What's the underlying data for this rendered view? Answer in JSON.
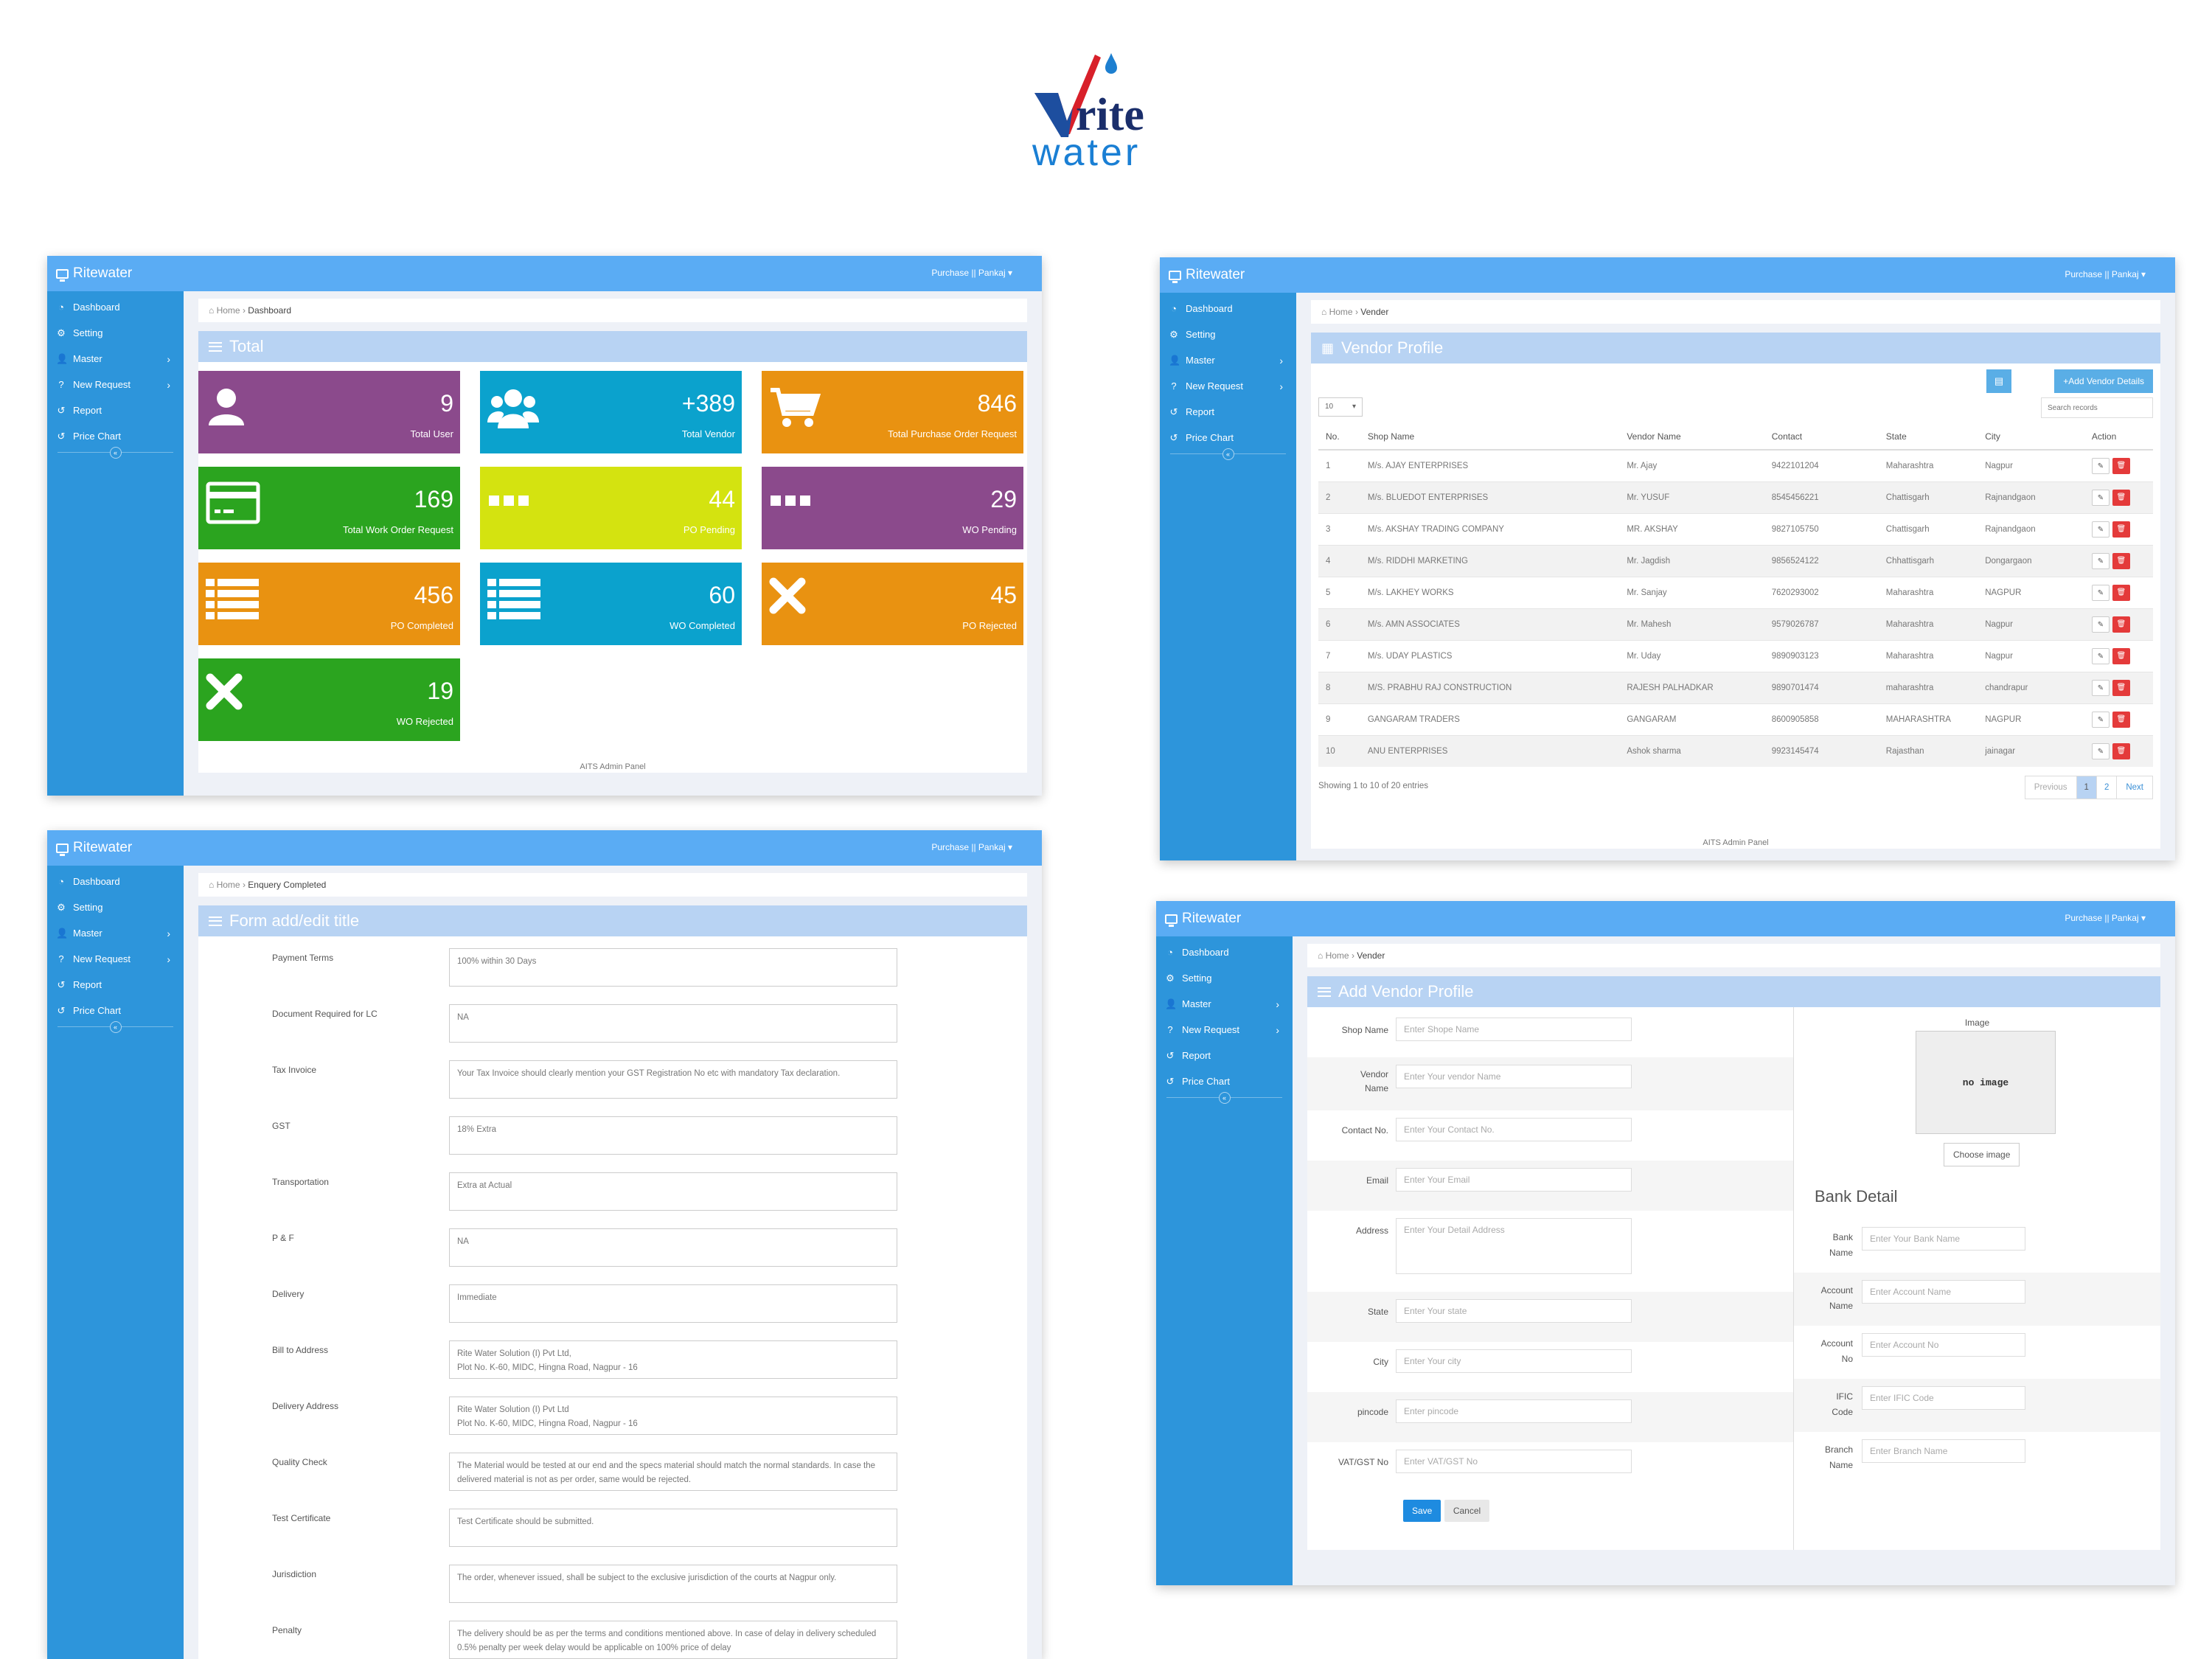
{
  "logo": {
    "top_text": "rite",
    "bottom_text": "water"
  },
  "common": {
    "brand": "Ritewater",
    "user": "Purchase || Pankaj",
    "nav": [
      {
        "label": "Dashboard",
        "icon": "dashboard-icon"
      },
      {
        "label": "Setting",
        "icon": "cogs-icon"
      },
      {
        "label": "Master",
        "icon": "user-icon"
      },
      {
        "label": "New Request",
        "icon": "question-icon"
      },
      {
        "label": "Report",
        "icon": "history-icon"
      },
      {
        "label": "Price Chart",
        "icon": "history-icon"
      }
    ],
    "home": "Home",
    "footer": "AITS Admin Panel"
  },
  "dashboard": {
    "crumb": "Dashboard",
    "title": "Total",
    "tiles": [
      {
        "value": "9",
        "label": "Total User",
        "color": "#8b4a8c",
        "icon": "user-icon"
      },
      {
        "value": "+389",
        "label": "Total Vendor",
        "color": "#0ba2cd",
        "icon": "users-icon"
      },
      {
        "value": "846",
        "label": "Total Purchase Order Request",
        "color": "#e99211",
        "icon": "cart-icon"
      },
      {
        "value": "169",
        "label": "Total Work Order Request",
        "color": "#2ba41f",
        "icon": "card-icon"
      },
      {
        "value": "44",
        "label": "PO Pending",
        "color": "#d4e310",
        "icon": "ellipsis-icon"
      },
      {
        "value": "29",
        "label": "WO Pending",
        "color": "#8b4a8c",
        "icon": "ellipsis-icon"
      },
      {
        "value": "456",
        "label": "PO Completed",
        "color": "#e99211",
        "icon": "list-icon"
      },
      {
        "value": "60",
        "label": "WO Completed",
        "color": "#0ba2cd",
        "icon": "list-icon"
      },
      {
        "value": "45",
        "label": "PO Rejected",
        "color": "#e99211",
        "icon": "x-icon"
      },
      {
        "value": "19",
        "label": "WO Rejected",
        "color": "#2ba41f",
        "icon": "x-icon"
      }
    ]
  },
  "vendors": {
    "crumb": "Vender",
    "title": "Vendor Profile",
    "add_label": "+Add Vendor Details",
    "page_size": "10",
    "search_placeholder": "Search records",
    "columns": [
      "No.",
      "Shop Name",
      "Vendor Name",
      "Contact",
      "State",
      "City",
      "Action"
    ],
    "rows": [
      [
        "1",
        "M/s. AJAY ENTERPRISES",
        "Mr. Ajay",
        "9422101204",
        "Maharashtra",
        "Nagpur"
      ],
      [
        "2",
        "M/s. BLUEDOT ENTERPRISES",
        "Mr. YUSUF",
        "8545456221",
        "Chattisgarh",
        "Rajnandgaon"
      ],
      [
        "3",
        "M/s. AKSHAY TRADING COMPANY",
        "MR. AKSHAY",
        "9827105750",
        "Chattisgarh",
        "Rajnandgaon"
      ],
      [
        "4",
        "M/s. RIDDHI MARKETING",
        "Mr. Jagdish",
        "9856524122",
        "Chhattisgarh",
        "Dongargaon"
      ],
      [
        "5",
        "M/s. LAKHEY WORKS",
        "Mr. Sanjay",
        "7620293002",
        "Maharashtra",
        "NAGPUR"
      ],
      [
        "6",
        "M/s. AMN ASSOCIATES",
        "Mr. Mahesh",
        "9579026787",
        "Maharashtra",
        "Nagpur"
      ],
      [
        "7",
        "M/s. UDAY PLASTICS",
        "Mr. Uday",
        "9890903123",
        "Maharashtra",
        "Nagpur"
      ],
      [
        "8",
        "M/S. PRABHU RAJ CONSTRUCTION",
        "RAJESH PALHADKAR",
        "9890701474",
        "maharashtra",
        "chandrapur"
      ],
      [
        "9",
        "GANGARAM TRADERS",
        "GANGARAM",
        "8600905858",
        "MAHARASHTRA",
        "NAGPUR"
      ],
      [
        "10",
        "ANU ENTERPRISES",
        "Ashok sharma",
        "9923145474",
        "Rajasthan",
        "jainagar"
      ]
    ],
    "showing": "Showing 1 to 10 of 20 entries",
    "pager": {
      "prev": "Previous",
      "p1": "1",
      "p2": "2",
      "next": "Next"
    }
  },
  "enquiry": {
    "crumb": "Enquery Completed",
    "title": "Form add/edit title",
    "fields": [
      {
        "label": "Payment Terms",
        "value": "100% within 30 Days"
      },
      {
        "label": "Document Required for LC",
        "value": "NA"
      },
      {
        "label": "Tax Invoice",
        "value": "Your Tax Invoice should clearly mention your GST Registration No etc with mandatory Tax declaration."
      },
      {
        "label": "GST",
        "value": "18% Extra"
      },
      {
        "label": "Transportation",
        "value": "Extra at Actual"
      },
      {
        "label": "P & F",
        "value": "NA"
      },
      {
        "label": "Delivery",
        "value": "Immediate"
      },
      {
        "label": "Bill to Address",
        "value": "Rite Water Solution (I) Pvt Ltd,\nPlot No. K-60, MIDC, Hingna Road, Nagpur - 16"
      },
      {
        "label": "Delivery Address",
        "value": "Rite Water Solution (I) Pvt Ltd\nPlot No. K-60, MIDC, Hingna Road, Nagpur - 16"
      },
      {
        "label": "Quality Check",
        "value": "The Material would be tested at our end and the specs material should match the normal standards. In case the delivered material is not as per order, same would be rejected."
      },
      {
        "label": "Test Certificate",
        "value": "Test Certificate should be submitted."
      },
      {
        "label": "Jurisdiction",
        "value": "The order, whenever issued, shall be subject to the exclusive jurisdiction of the courts at Nagpur only."
      },
      {
        "label": "Penalty",
        "value": "The delivery should be as per the terms and conditions mentioned above. In case of delay in delivery scheduled 0.5% penalty per week delay would be applicable on 100% price of delay"
      }
    ]
  },
  "add_vendor": {
    "crumb": "Vender",
    "title": "Add Vendor Profile",
    "fields": [
      {
        "label": "Shop Name",
        "placeholder": "Enter Shope Name"
      },
      {
        "label": "Vendor Name",
        "placeholder": "Enter Your vendor Name"
      },
      {
        "label": "Contact No.",
        "placeholder": "Enter Your Contact No."
      },
      {
        "label": "Email",
        "placeholder": "Enter Your Email"
      },
      {
        "label": "Address",
        "placeholder": "Enter Your Detail Address"
      },
      {
        "label": "State",
        "placeholder": "Enter Your state"
      },
      {
        "label": "City",
        "placeholder": "Enter Your city"
      },
      {
        "label": "pincode",
        "placeholder": "Enter pincode"
      },
      {
        "label": "VAT/GST No",
        "placeholder": "Enter VAT/GST No"
      }
    ],
    "save": "Save",
    "cancel": "Cancel",
    "image_label": "Image",
    "no_image": "no image",
    "choose_image": "Choose image",
    "bank_title": "Bank Detail",
    "bank_fields": [
      {
        "label": "Bank Name",
        "placeholder": "Enter Your Bank Name"
      },
      {
        "label": "Account Name",
        "placeholder": "Enter Account Name"
      },
      {
        "label": "Account No",
        "placeholder": "Enter Account No"
      },
      {
        "label": "IFIC Code",
        "placeholder": "Enter IFIC Code"
      },
      {
        "label": "Branch Name",
        "placeholder": "Enter Branch Name"
      }
    ]
  }
}
